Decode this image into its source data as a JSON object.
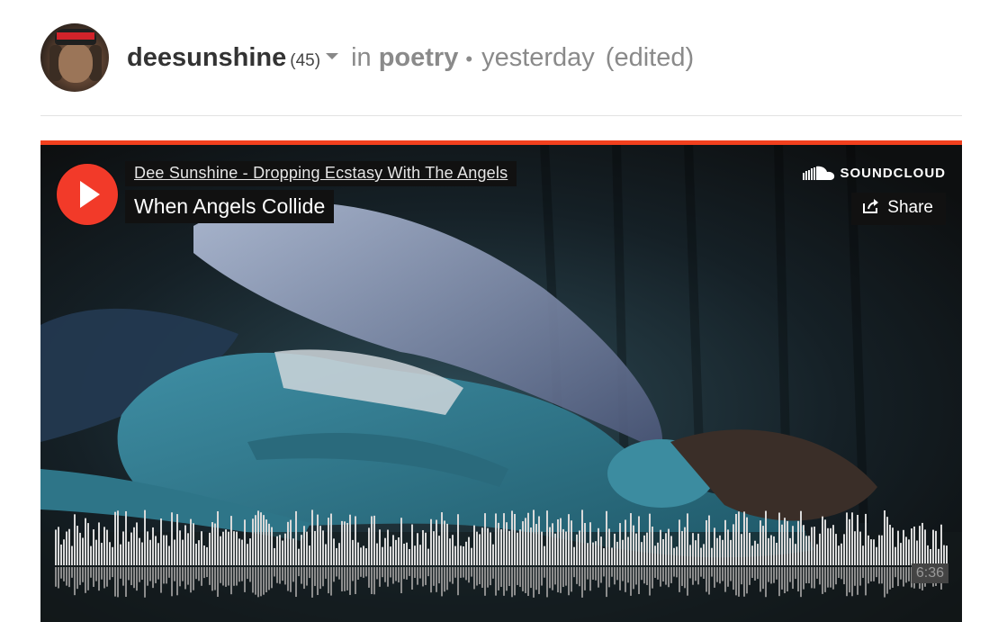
{
  "post": {
    "author": "deesunshine",
    "reputation": "(45)",
    "in_word": "in",
    "community": "poetry",
    "separator": "•",
    "time": "yesterday",
    "edited": "(edited)"
  },
  "player": {
    "brand": "SOUNDCLOUD",
    "uploader_track": "Dee Sunshine - Dropping Ecstasy With The Angels",
    "title": "When Angels Collide",
    "share_label": "Share",
    "duration": "6:36",
    "accent_color": "#f2401e",
    "play_icon": "play-icon",
    "share_icon": "share-icon",
    "brand_icon": "soundcloud-cloud-icon"
  }
}
